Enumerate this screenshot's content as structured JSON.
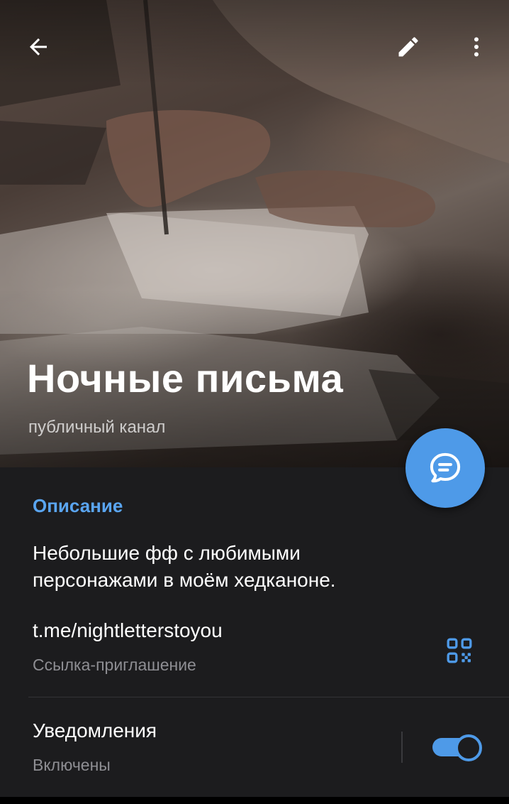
{
  "header": {
    "back_icon": "arrow-left-icon",
    "edit_icon": "pencil-icon",
    "more_icon": "more-vertical-icon",
    "title": "Ночные письма",
    "subtitle": "публичный канал",
    "fab_icon": "chat-bubble-icon"
  },
  "info": {
    "description_label": "Описание",
    "description_text": "Небольшие фф с любимыми персонажами в моём хедканоне.",
    "link": "t.me/nightletterstoyou",
    "link_caption": "Ссылка-приглашение",
    "qr_icon": "qr-code-icon"
  },
  "notifications": {
    "title": "Уведомления",
    "status": "Включены",
    "enabled": true
  },
  "colors": {
    "accent": "#4e9ae8",
    "label_accent": "#5aa5f0",
    "background": "#1c1c1e",
    "secondary_text": "#8e8e93"
  }
}
